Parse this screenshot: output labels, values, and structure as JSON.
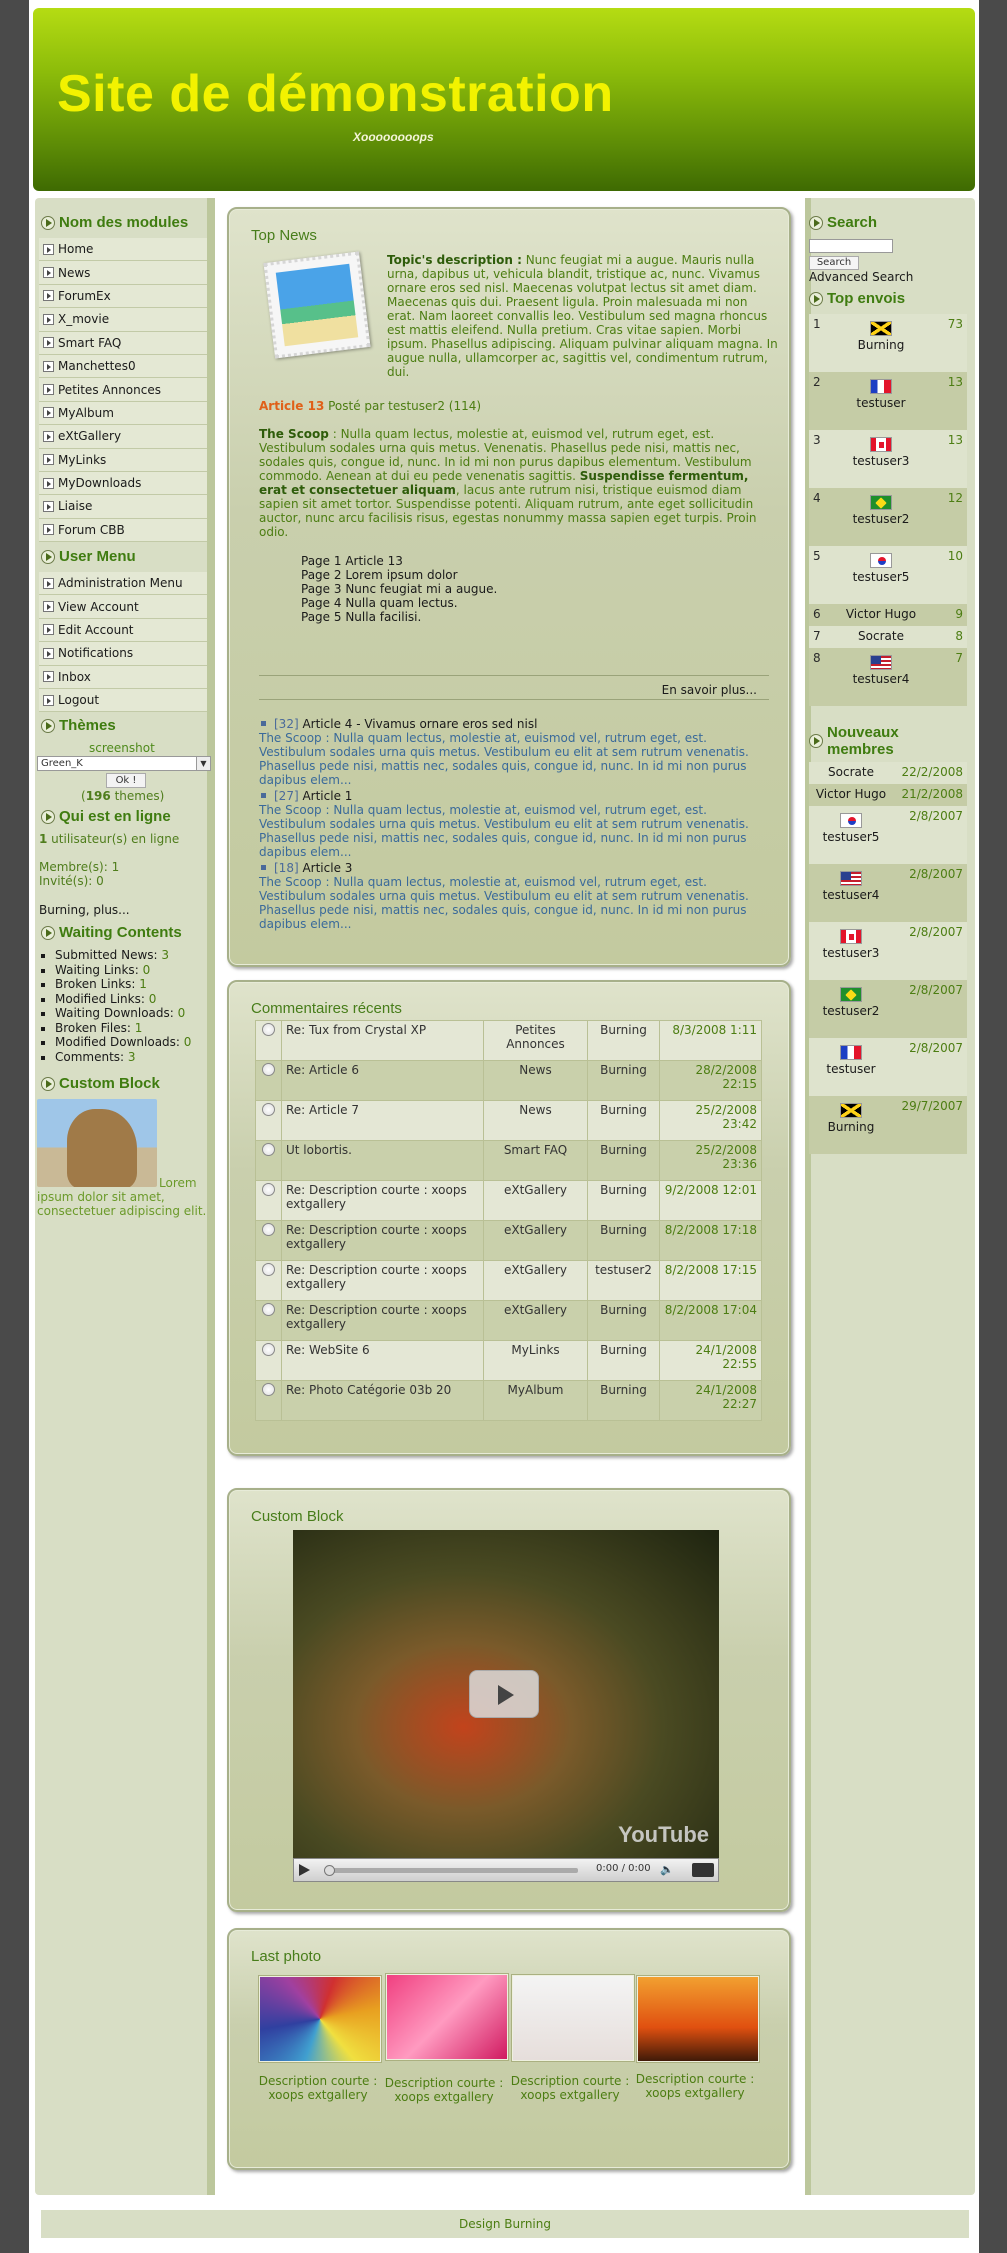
{
  "header": {
    "site_title": "Site de démonstration",
    "slogan": "Xoooooooops"
  },
  "left": {
    "modules_title": "Nom des modules",
    "modules": [
      "Home",
      "News",
      "ForumEx",
      "X_movie",
      "Smart FAQ",
      "Manchettes0",
      "Petites Annonces",
      "MyAlbum",
      "eXtGallery",
      "MyLinks",
      "MyDownloads",
      "Liaise",
      "Forum CBB"
    ],
    "user_menu_title": "User Menu",
    "user_menu": [
      "Administration Menu",
      "View Account",
      "Edit Account",
      "Notifications",
      "Inbox",
      "Logout"
    ],
    "themes_title": "Thèmes",
    "theme_screenshot_label": "screenshot",
    "theme_selected": "Green_K",
    "theme_ok": "Ok !",
    "theme_count_prefix": "(",
    "theme_count": "196",
    "theme_count_suffix": " themes)",
    "online_title": "Qui est en ligne",
    "online_count": "1",
    "online_text": " utilisateur(s) en ligne",
    "members_online": "Membre(s): 1",
    "guests_online": "Invité(s): 0",
    "online_users": "Burning,",
    "online_more": " plus...",
    "waiting_title": "Waiting Contents",
    "waiting": [
      {
        "label": "Submitted News:",
        "count": "3"
      },
      {
        "label": "Waiting Links:",
        "count": "0"
      },
      {
        "label": "Broken Links:",
        "count": "1"
      },
      {
        "label": "Modified Links:",
        "count": "0"
      },
      {
        "label": "Waiting Downloads:",
        "count": "0"
      },
      {
        "label": "Broken Files:",
        "count": "1"
      },
      {
        "label": "Modified Downloads:",
        "count": "0"
      },
      {
        "label": "Comments:",
        "count": "3"
      }
    ],
    "custom_title": "Custom Block",
    "custom_text": "Lorem ipsum dolor sit amet, consectetuer adipiscing elit."
  },
  "top_news": {
    "title": "Top News",
    "desc_label": "Topic's description :",
    "desc_text": " Nunc feugiat mi a augue. Mauris nulla urna, dapibus ut, vehicula blandit, tristique ac, nunc. Vivamus ornare eros sed nisl. Maecenas volutpat lectus sit amet diam. Maecenas quis dui. Praesent ligula. Proin malesuada mi non erat. Nam laoreet convallis leo. Vestibulum sed magna rhoncus est mattis eleifend. Nulla pretium. Cras vitae sapien. Morbi ipsum. Phasellus adipiscing. Aliquam pulvinar aliquam magna. In augue nulla, ullamcorper ac, sagittis vel, condimentum rutrum, dui.",
    "article_label": "Article 13",
    "posted_by": " Posté par testuser2 (114)",
    "scoop_label": "The Scoop",
    "scoop_text1": " : Nulla quam lectus, molestie at, euismod vel, rutrum eget, est. Vestibulum sodales urna quis metus. Venenatis. Phasellus pede nisi, mattis nec, sodales quis, congue id, nunc. In id mi non purus dapibus elementum. Vestibulum commodo. Aenean at dui eu pede venenatis sagittis. ",
    "scoop_bold": "Suspendisse fermentum, erat et consectetuer aliquam",
    "scoop_text2": ", lacus ante rutrum nisi, tristique euismod diam sapien sit amet tortor. Suspendisse potenti. Aliquam rutrum, ante eget sollicitudin auctor, nunc arcu facilisis risus, egestas nonummy massa sapien eget turpis. Proin odio.",
    "pages": [
      "Page 1 Article 13",
      "Page 2 Lorem ipsum dolor",
      "Page 3 Nunc feugiat mi a augue.",
      "Page 4 Nulla quam lectus.",
      "Page 5 Nulla facilisi."
    ],
    "read_more": "En savoir plus...",
    "items": [
      {
        "num": "[32]",
        "title": " Article 4 - Vivamus ornare eros sed nisl",
        "text": "The Scoop : Nulla quam lectus, molestie at, euismod vel, rutrum eget, est. Vestibulum sodales urna quis metus. Vestibulum eu elit at sem rutrum venenatis. Phasellus pede nisi, mattis nec, sodales quis, congue id, nunc. In id mi non purus dapibus elem..."
      },
      {
        "num": "[27]",
        "title": " Article 1",
        "text": "The Scoop : Nulla quam lectus, molestie at, euismod vel, rutrum eget, est. Vestibulum sodales urna quis metus. Vestibulum eu elit at sem rutrum venenatis. Phasellus pede nisi, mattis nec, sodales quis, congue id, nunc. In id mi non purus dapibus elem..."
      },
      {
        "num": "[18]",
        "title": " Article 3",
        "text": "The Scoop : Nulla quam lectus, molestie at, euismod vel, rutrum eget, est. Vestibulum sodales urna quis metus. Vestibulum eu elit at sem rutrum venenatis. Phasellus pede nisi, mattis nec, sodales quis, congue id, nunc. In id mi non purus dapibus elem..."
      }
    ]
  },
  "comments": {
    "title": "Commentaires récents",
    "rows": [
      {
        "title": "Re: Tux from Crystal XP",
        "module": "Petites Annonces",
        "user": "Burning",
        "date": "8/3/2008 1:11"
      },
      {
        "title": "Re: Article 6",
        "module": "News",
        "user": "Burning",
        "date": "28/2/2008 22:15"
      },
      {
        "title": "Re: Article 7",
        "module": "News",
        "user": "Burning",
        "date": "25/2/2008 23:42"
      },
      {
        "title": "Ut lobortis.",
        "module": "Smart FAQ",
        "user": "Burning",
        "date": "25/2/2008 23:36"
      },
      {
        "title": "Re: Description courte : xoops extgallery",
        "module": "eXtGallery",
        "user": "Burning",
        "date": "9/2/2008 12:01"
      },
      {
        "title": "Re: Description courte : xoops extgallery",
        "module": "eXtGallery",
        "user": "Burning",
        "date": "8/2/2008 17:18"
      },
      {
        "title": "Re: Description courte : xoops extgallery",
        "module": "eXtGallery",
        "user": "testuser2",
        "date": "8/2/2008 17:15"
      },
      {
        "title": "Re: Description courte : xoops extgallery",
        "module": "eXtGallery",
        "user": "Burning",
        "date": "8/2/2008 17:04"
      },
      {
        "title": "Re: WebSite 6",
        "module": "MyLinks",
        "user": "Burning",
        "date": "24/1/2008 22:55"
      },
      {
        "title": "Re: Photo Catégorie 03b 20",
        "module": "MyAlbum",
        "user": "Burning",
        "date": "24/1/2008 22:27"
      }
    ]
  },
  "custom_video": {
    "title": "Custom Block",
    "time": "0:00 / 0:00",
    "logo": "YouTube"
  },
  "last_photo": {
    "title": "Last photo",
    "captions": [
      "Description courte : xoops extgallery",
      "Description courte : xoops extgallery",
      "Description courte : xoops extgallery",
      "Description courte : xoops extgallery"
    ]
  },
  "right": {
    "search_title": "Search",
    "search_button": "Search",
    "advanced_search": "Advanced Search",
    "top_title": "Top envois",
    "top": [
      {
        "rank": "1",
        "user": "Burning",
        "count": "73",
        "flag": "jm"
      },
      {
        "rank": "2",
        "user": "testuser",
        "count": "13",
        "flag": "fr"
      },
      {
        "rank": "3",
        "user": "testuser3",
        "count": "13",
        "flag": "ca"
      },
      {
        "rank": "4",
        "user": "testuser2",
        "count": "12",
        "flag": "br"
      },
      {
        "rank": "5",
        "user": "testuser5",
        "count": "10",
        "flag": "kr"
      },
      {
        "rank": "6",
        "user": "Victor Hugo",
        "count": "9",
        "flag": ""
      },
      {
        "rank": "7",
        "user": "Socrate",
        "count": "8",
        "flag": ""
      },
      {
        "rank": "8",
        "user": "testuser4",
        "count": "7",
        "flag": "us"
      }
    ],
    "new_title": "Nouveaux membres",
    "new_members": [
      {
        "user": "Socrate",
        "date": "22/2/2008",
        "flag": ""
      },
      {
        "user": "Victor Hugo",
        "date": "21/2/2008",
        "flag": ""
      },
      {
        "user": "testuser5",
        "date": "2/8/2007",
        "flag": "kr"
      },
      {
        "user": "testuser4",
        "date": "2/8/2007",
        "flag": "us"
      },
      {
        "user": "testuser3",
        "date": "2/8/2007",
        "flag": "ca"
      },
      {
        "user": "testuser2",
        "date": "2/8/2007",
        "flag": "br"
      },
      {
        "user": "testuser",
        "date": "2/8/2007",
        "flag": "fr"
      },
      {
        "user": "Burning",
        "date": "29/7/2007",
        "flag": "jm"
      }
    ]
  },
  "footer": {
    "text": "Design Burning"
  }
}
